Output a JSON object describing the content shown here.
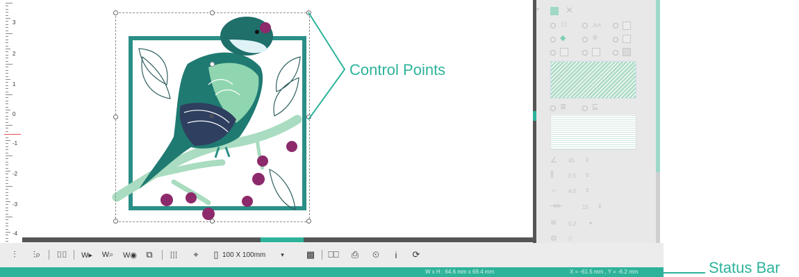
{
  "ruler": {
    "labels": [
      "3",
      "2",
      "1",
      "0",
      "-1",
      "-2",
      "-3",
      "-4"
    ]
  },
  "panel": {
    "params": [
      {
        "icon": "angle-icon",
        "value": "45"
      },
      {
        "icon": "density-icon",
        "value": "0.5"
      },
      {
        "icon": "length-icon",
        "value": "4.0"
      },
      {
        "icon": "offset-icon",
        "value": "15"
      },
      {
        "icon": "pull-comp-icon",
        "value": "0.2"
      }
    ]
  },
  "toolbar": {
    "size_label": "100 X 100mm",
    "size_arrow": "▾"
  },
  "status": {
    "dimensions": "W x H : 64.6 mm x 69.4 mm",
    "coordinates": "X = -61.5 mm , Y = -6.2 mm"
  },
  "annotations": {
    "control_points": "Control Points",
    "status_bar": "Status Bar"
  },
  "colors": {
    "accent": "#2db39a",
    "embroidery_dark_teal": "#1f6f6a",
    "embroidery_light_green": "#8fd6b0",
    "embroidery_berry": "#8c2a6b",
    "embroidery_navy": "#2f3f5f"
  }
}
